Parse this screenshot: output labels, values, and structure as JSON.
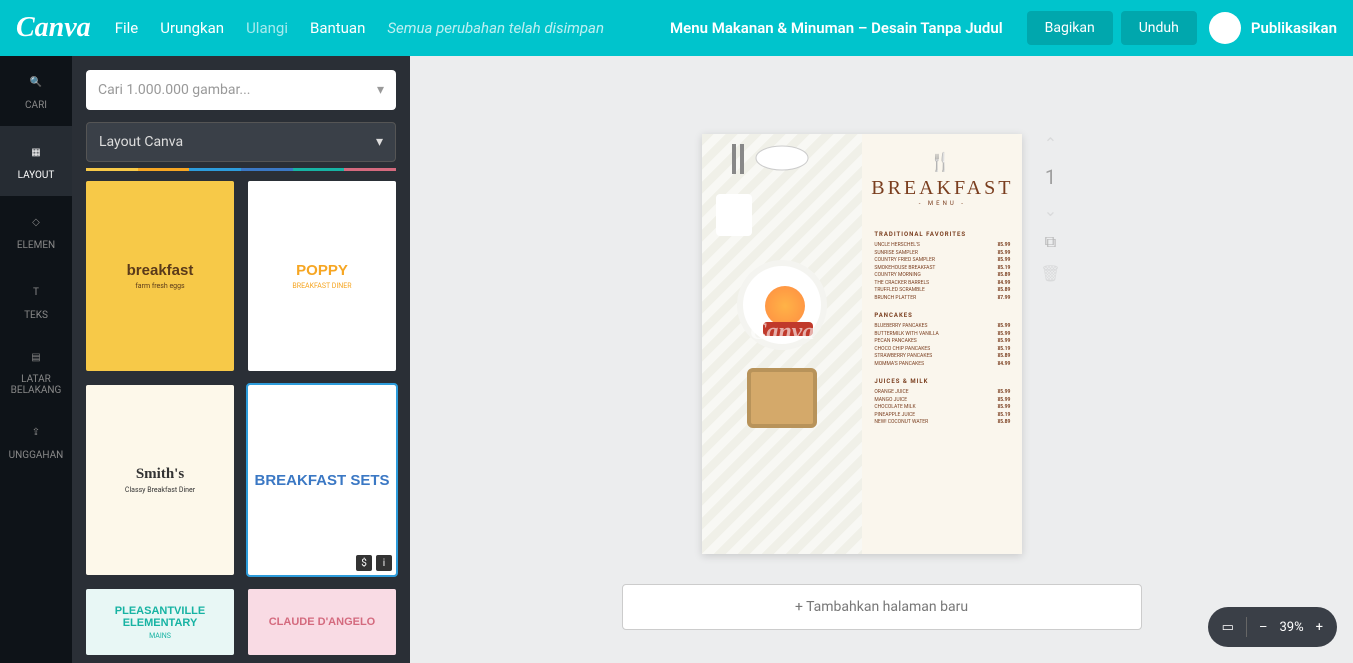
{
  "topbar": {
    "logo": "Canva",
    "menu": [
      "File",
      "Urungkan",
      "Ulangi",
      "Bantuan"
    ],
    "saveStatus": "Semua perubahan telah disimpan",
    "docTitle": "Menu Makanan & Minuman – Desain Tanpa Judul",
    "share": "Bagikan",
    "download": "Unduh",
    "publish": "Publikasikan"
  },
  "rail": [
    {
      "label": "CARI",
      "icon": "search"
    },
    {
      "label": "LAYOUT",
      "icon": "layout"
    },
    {
      "label": "ELEMEN",
      "icon": "shapes"
    },
    {
      "label": "TEKS",
      "icon": "text"
    },
    {
      "label": "LATAR BELAKANG",
      "icon": "bg"
    },
    {
      "label": "UNGGAHAN",
      "icon": "upload"
    }
  ],
  "panel": {
    "searchPlaceholder": "Cari 1.000.000 gambar...",
    "dropdown": "Layout Canva"
  },
  "templates": [
    {
      "title": "breakfast",
      "theme": "#f7c948",
      "accent": "#5a3a1a",
      "sub": "farm fresh eggs"
    },
    {
      "title": "POPPY",
      "theme": "#fff",
      "accent": "#f6a623",
      "sub": "BREAKFAST DINER"
    },
    {
      "title": "Smith's",
      "theme": "#fdf8ea",
      "accent": "#333",
      "sub": "Classy Breakfast Diner"
    },
    {
      "title": "BREAKFAST SETS",
      "theme": "#fff",
      "accent": "#3b78c4",
      "sub": ""
    },
    {
      "title": "PLEASANTVILLE ELEMENTARY",
      "theme": "#e8f7f5",
      "accent": "#17b3a3",
      "sub": "MAINS"
    },
    {
      "title": "CLAUDE D'ANGELO",
      "theme": "#f9dbe4",
      "accent": "#d46a7e",
      "sub": ""
    }
  ],
  "canvas": {
    "watermark": "Canva",
    "title": "BREAKFAST",
    "subtitle": "- MENU -",
    "sections": [
      {
        "name": "TRADITIONAL FAVORITES",
        "items": [
          {
            "n": "UNCLE HERSCHEL'S",
            "p": "¥5.99"
          },
          {
            "n": "SUNRISE SAMPLER",
            "p": "¥5.99"
          },
          {
            "n": "COUNTRY FRIED SAMPLER",
            "p": "¥5.99"
          },
          {
            "n": "SMOKEHOUSE BREAKFAST",
            "p": "¥5.19"
          },
          {
            "n": "COUNTRY MORNING",
            "p": "¥5.89"
          },
          {
            "n": "THE CRACKER BARRELS",
            "p": "¥4.99"
          },
          {
            "n": "TRUFFLED SCRAMBLE",
            "p": "¥5.89"
          },
          {
            "n": "BRUNCH PLATTER",
            "p": "¥7.99"
          }
        ]
      },
      {
        "name": "PANCAKES",
        "items": [
          {
            "n": "BLUEBERRY PANCAKES",
            "p": "¥5.99"
          },
          {
            "n": "BUTTERMILK WITH VANILLA",
            "p": "¥5.99"
          },
          {
            "n": "PECAN PANCAKES",
            "p": "¥5.99"
          },
          {
            "n": "CHOCO CHIP PANCAKES",
            "p": "¥5.19"
          },
          {
            "n": "STRAWBERRY PANCAKES",
            "p": "¥5.89"
          },
          {
            "n": "MOMMA'S PANCAKES",
            "p": "¥4.99"
          }
        ]
      },
      {
        "name": "JUICES & MILK",
        "items": [
          {
            "n": "ORANGE JUICE",
            "p": "¥5.99"
          },
          {
            "n": "MANGO JUICE",
            "p": "¥5.99"
          },
          {
            "n": "CHOCOLATE MILK",
            "p": "¥5.99"
          },
          {
            "n": "PINEAPPLE JUICE",
            "p": "¥5.19"
          },
          {
            "n": "NEW! COCONUT WATER",
            "p": "¥5.89"
          }
        ]
      }
    ],
    "pageNum": "1",
    "addPage": "+ Tambahkan halaman baru"
  },
  "zoom": {
    "level": "39%",
    "minus": "–",
    "plus": "+"
  }
}
